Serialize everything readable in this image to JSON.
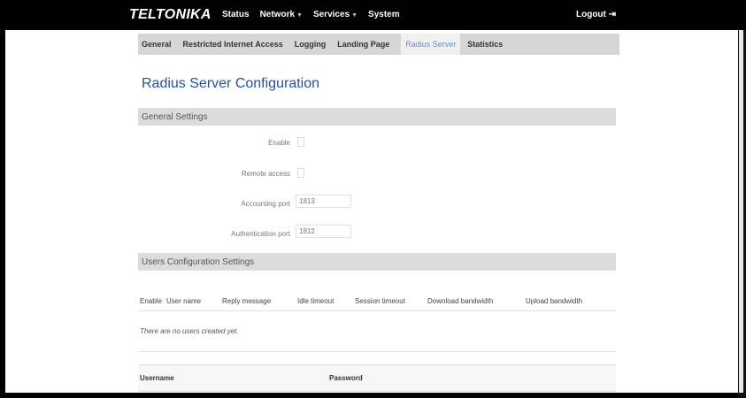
{
  "header": {
    "brand": "TELTONIKA",
    "nav": [
      "Status",
      "Network",
      "Services",
      "System"
    ],
    "logout": "Logout"
  },
  "tabs": [
    "General",
    "Restricted Internet Access",
    "Logging",
    "Landing Page",
    "Radius Server",
    "Statistics"
  ],
  "active_tab": "Radius Server",
  "page_title": "Radius Server Configuration",
  "general_settings": {
    "title": "General Settings",
    "enable_label": "Enable",
    "remote_access_label": "Remote access",
    "accounting_port_label": "Accounting port",
    "accounting_port_value": "1813",
    "authentication_port_label": "Authentication port",
    "authentication_port_value": "1812"
  },
  "users_settings": {
    "title": "Users Configuration Settings",
    "columns": [
      "Enable",
      "User name",
      "Reply message",
      "Idle timeout",
      "Session timeout",
      "Download bandwidth",
      "Upload bandwidth"
    ],
    "empty_message": "There are no users created yet."
  },
  "new_user_table": {
    "username_header": "Username",
    "password_header": "Password"
  },
  "colors": {
    "title_blue": "#254f9a",
    "active_tab": "#6a8fc2",
    "section_bg": "#dcdcdc"
  }
}
